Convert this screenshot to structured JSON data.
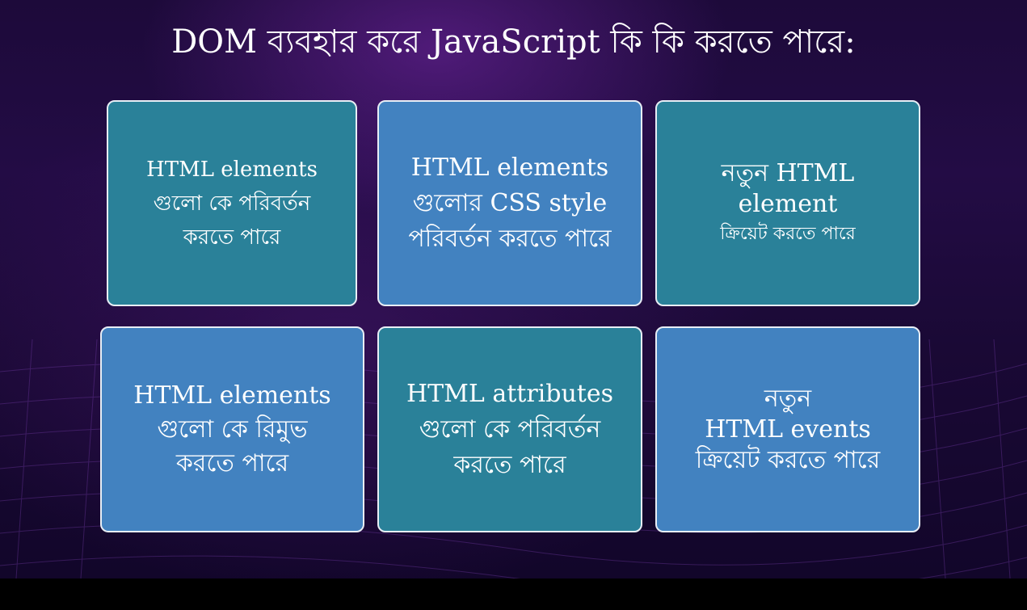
{
  "title": "DOM ব্যবহার করে JavaScript কি কি করতে পারে:",
  "cards": [
    {
      "text": "HTML elements\nগুলো কে পরিবর্তন\nকরতে পারে"
    },
    {
      "text": "HTML elements\nগুলোর CSS style\nপরিবর্তন করতে পারে"
    },
    {
      "text": "নতুন HTML\nelement",
      "subtext": "ক্রিয়েট করতে পারে"
    },
    {
      "text": "HTML elements\nগুলো কে রিমুভ\nকরতে পারে"
    },
    {
      "text": "HTML attributes\nগুলো কে পরিবর্তন\nকরতে পারে"
    },
    {
      "text": "নতুন\nHTML events\nক্রিয়েট করতে পারে"
    }
  ],
  "colors": {
    "teal_card": "#2a8199",
    "blue_card": "#4282c0",
    "card_border": "#e8eef5",
    "background": "#1d0a3a"
  }
}
